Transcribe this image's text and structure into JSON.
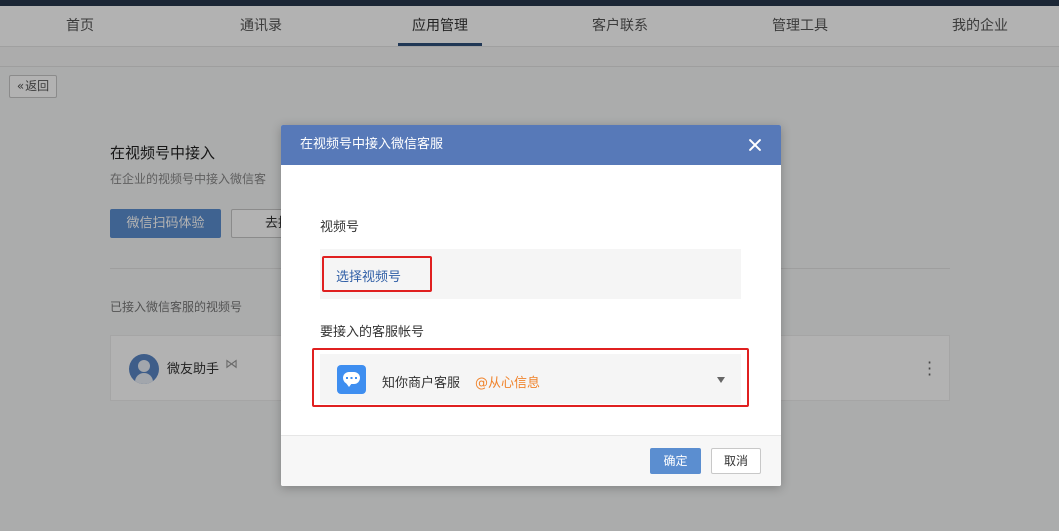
{
  "nav": {
    "tabs": [
      {
        "label": "首页"
      },
      {
        "label": "通讯录"
      },
      {
        "label": "应用管理",
        "active": true
      },
      {
        "label": "客户联系"
      },
      {
        "label": "管理工具"
      },
      {
        "label": "我的企业"
      }
    ]
  },
  "page": {
    "back_label": "返回",
    "title": "在视频号中接入",
    "desc": "在企业的视频号中接入微信客",
    "primary_button": "微信扫码体验",
    "secondary_button": "去接入",
    "section_title": "已接入微信客服的视频号",
    "channel": {
      "name": "微友助手",
      "flag": "⋈"
    }
  },
  "modal": {
    "title": "在视频号中接入微信客服",
    "channel_label": "视频号",
    "channel_select_link": "选择视频号",
    "account_label": "要接入的客服帐号",
    "account": {
      "name": "知你商户客服",
      "org": "@从心信息"
    },
    "ok_label": "确定",
    "cancel_label": "取消"
  },
  "colors": {
    "header": "#5779b8",
    "primary": "#5b8ed0",
    "highlight": "#e02020",
    "org_text": "#f0832b"
  }
}
